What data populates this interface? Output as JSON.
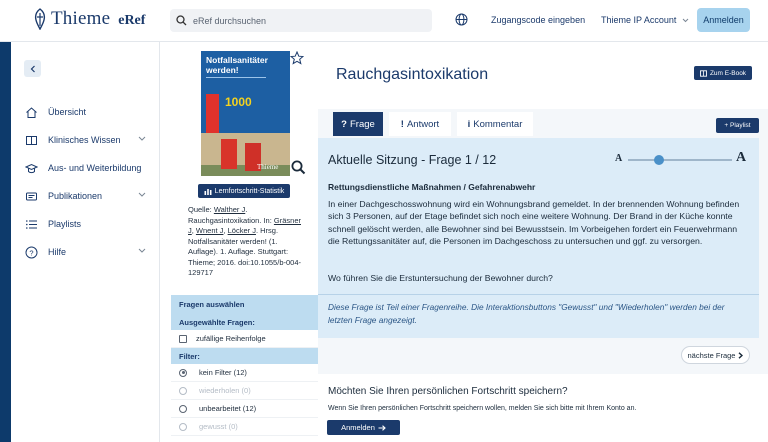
{
  "header": {
    "logo_text": "Thieme",
    "logo_sub": "eRef",
    "search_placeholder": "eRef durchsuchen",
    "access_code": "Zugangscode eingeben",
    "account": "Thieme IP Account",
    "login": "Anmelden"
  },
  "sidebar": {
    "items": [
      {
        "label": "Übersicht",
        "icon": "home-icon"
      },
      {
        "label": "Klinisches Wissen",
        "icon": "book-icon",
        "expandable": true
      },
      {
        "label": "Aus- und Weiterbildung",
        "icon": "graduation-cap-icon"
      },
      {
        "label": "Publikationen",
        "icon": "publication-icon",
        "expandable": true
      },
      {
        "label": "Playlists",
        "icon": "list-icon"
      },
      {
        "label": "Hilfe",
        "icon": "help-icon",
        "expandable": true
      }
    ]
  },
  "book": {
    "cover_title": "Notfallsanitäter werden!",
    "cover_number": "1000",
    "cover_publisher": "Thieme",
    "progress_button": "Lernfortschritt-Statistik",
    "source_label": "Quelle:",
    "source_author1": "Walther J",
    "source_title": ". Rauchgasintoxikation. In:",
    "source_editors": [
      {
        "text": "Gräsner J",
        "link": true
      },
      {
        "text": ", ",
        "link": false
      },
      {
        "text": "Wnent J",
        "link": true
      },
      {
        "text": ", ",
        "link": false
      },
      {
        "text": "Löcker J",
        "link": true
      }
    ],
    "source_rest": ". Hrsg. Notfallsanitäter werden! (1. Auflage). 1. Auflage. Stuttgart: Thieme; 2016. doi:10.1055/b-004-129717"
  },
  "filters": {
    "select_heading": "Fragen auswählen",
    "selected_heading": "Ausgewählte Fragen:",
    "random_order": "zufällige Reihenfolge",
    "filter_heading": "Filter:",
    "options": [
      {
        "label": "kein Filter (12)",
        "selected": true,
        "disabled": false
      },
      {
        "label": "wiederholen (0)",
        "selected": false,
        "disabled": true
      },
      {
        "label": "unbearbeitet (12)",
        "selected": false,
        "disabled": false
      },
      {
        "label": "gewusst (0)",
        "selected": false,
        "disabled": true
      }
    ]
  },
  "main": {
    "title": "Rauchgasintoxikation",
    "ebook_button": "Zum E-Book",
    "playlist_button": "+ Playlist",
    "tabs": [
      {
        "label": "Frage",
        "glyph": "?",
        "active": true
      },
      {
        "label": "Antwort",
        "glyph": "!",
        "active": false
      },
      {
        "label": "Kommentar",
        "glyph": "i",
        "active": false
      }
    ],
    "session_heading": "Aktuelle Sitzung - Frage 1 / 12",
    "font_small": "A",
    "font_large": "A",
    "font_size_level": 0.3,
    "question_category": "Rettungsdienstliche Maßnahmen / Gefahrenabwehr",
    "question_text": "In einer Dachgeschosswohnung wird ein Wohnungsbrand gemeldet. In der brennenden Wohnung befinden sich 3 Personen, auf der Etage befindet sich noch eine weitere Wohnung. Der Brand in der Küche konnte schnell gelöscht werden, alle Bewohner sind bei Bewusstsein. Im Vorbeigehen fordert ein Feuerwehrmann die Rettungssanitäter auf, die Personen im Dachgeschoss zu untersuchen und ggf. zu versorgen.",
    "question_ask": "Wo führen Sie die Erstuntersuchung der Bewohner durch?",
    "series_note": "Diese Frage ist Teil einer Fragenreihe. Die Interaktionsbuttons \"Gewusst\" und \"Wiederholen\" werden bei der letzten Frage angezeigt.",
    "next_button": "nächste Frage",
    "save_title": "Möchten Sie Ihren persönlichen Fortschritt speichern?",
    "save_text": "Wenn Sie Ihren persönlichen Fortschritt speichern wollen, melden Sie sich bitte mit Ihrem Konto an.",
    "save_login": "Anmelden"
  },
  "colors": {
    "brand": "#1b3a6b",
    "accent_light": "#a7d3ee",
    "card_bg": "#dcecf8"
  }
}
